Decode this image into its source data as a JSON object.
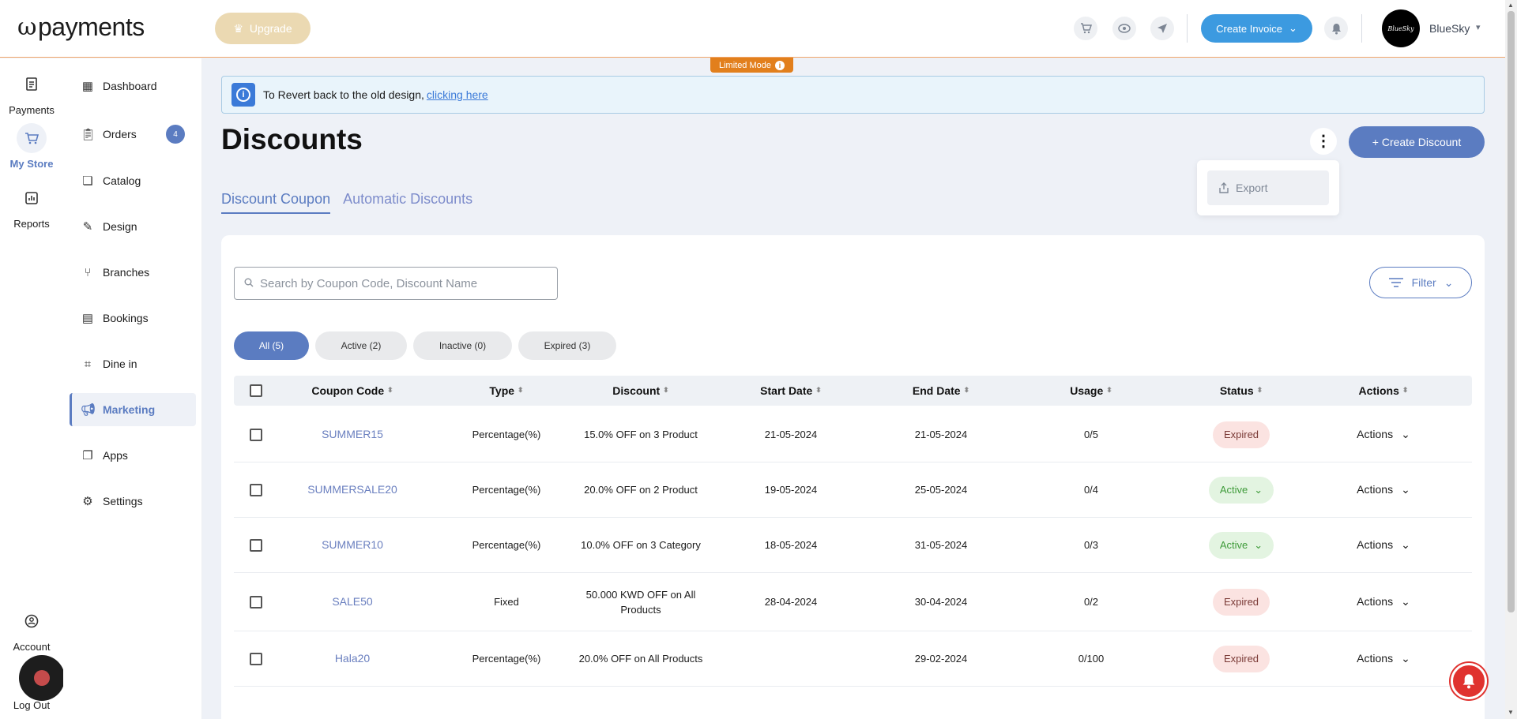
{
  "header": {
    "logo_text": "payments",
    "upgrade_label": "Upgrade",
    "create_invoice_label": "Create Invoice",
    "avatar_text": "BlueSky",
    "username": "BlueSky"
  },
  "rail": {
    "payments": "Payments",
    "my_store": "My Store",
    "reports": "Reports",
    "account": "Account",
    "logout": "Log Out"
  },
  "sidenav": {
    "items": [
      {
        "label": "Dashboard",
        "icon": "grid-icon"
      },
      {
        "label": "Orders",
        "icon": "clipboard-icon",
        "badge": "4"
      },
      {
        "label": "Catalog",
        "icon": "catalog-icon"
      },
      {
        "label": "Design",
        "icon": "design-icon"
      },
      {
        "label": "Branches",
        "icon": "branch-icon"
      },
      {
        "label": "Bookings",
        "icon": "calendar-icon"
      },
      {
        "label": "Dine in",
        "icon": "qr-icon"
      },
      {
        "label": "Marketing",
        "icon": "megaphone-icon",
        "active": true
      },
      {
        "label": "Apps",
        "icon": "apps-icon"
      },
      {
        "label": "Settings",
        "icon": "gear-icon"
      }
    ]
  },
  "banner": {
    "limited_mode": "Limited Mode",
    "revert_text": "To Revert back to the old design,",
    "revert_link": "clicking here"
  },
  "page": {
    "title": "Discounts",
    "create_discount_label": "+ Create Discount",
    "export_label": "Export",
    "tabs": [
      "Discount Coupon",
      "Automatic Discounts"
    ]
  },
  "toolbar": {
    "search_placeholder": "Search by Coupon Code, Discount Name",
    "filter_label": "Filter",
    "chips": [
      "All (5)",
      "Active (2)",
      "Inactive (0)",
      "Expired (3)"
    ]
  },
  "table": {
    "columns": [
      "Coupon Code",
      "Type",
      "Discount",
      "Start Date",
      "End Date",
      "Usage",
      "Status",
      "Actions"
    ],
    "rows": [
      {
        "code": "SUMMER15",
        "type": "Percentage(%)",
        "discount": "15.0% OFF on 3 Product",
        "start": "21-05-2024",
        "end": "21-05-2024",
        "usage": "0/5",
        "status": "Expired",
        "actions": "Actions"
      },
      {
        "code": "SUMMERSALE20",
        "type": "Percentage(%)",
        "discount": "20.0% OFF on 2 Product",
        "start": "19-05-2024",
        "end": "25-05-2024",
        "usage": "0/4",
        "status": "Active",
        "actions": "Actions"
      },
      {
        "code": "SUMMER10",
        "type": "Percentage(%)",
        "discount": "10.0% OFF on 3 Category",
        "start": "18-05-2024",
        "end": "31-05-2024",
        "usage": "0/3",
        "status": "Active",
        "actions": "Actions"
      },
      {
        "code": "SALE50",
        "type": "Fixed",
        "discount": "50.000 KWD OFF on All Products",
        "start": "28-04-2024",
        "end": "30-04-2024",
        "usage": "0/2",
        "status": "Expired",
        "actions": "Actions"
      },
      {
        "code": "Hala20",
        "type": "Percentage(%)",
        "discount": "20.0% OFF on All Products",
        "start": "",
        "end": "29-02-2024",
        "usage": "0/100",
        "status": "Expired",
        "actions": "Actions"
      }
    ]
  },
  "colors": {
    "accent": "#5b7cc1",
    "invoice_blue": "#3c9ae0",
    "limited_orange": "#e27f1c",
    "expired_bg": "#fbe3e1",
    "active_bg": "#e3f4e1"
  }
}
